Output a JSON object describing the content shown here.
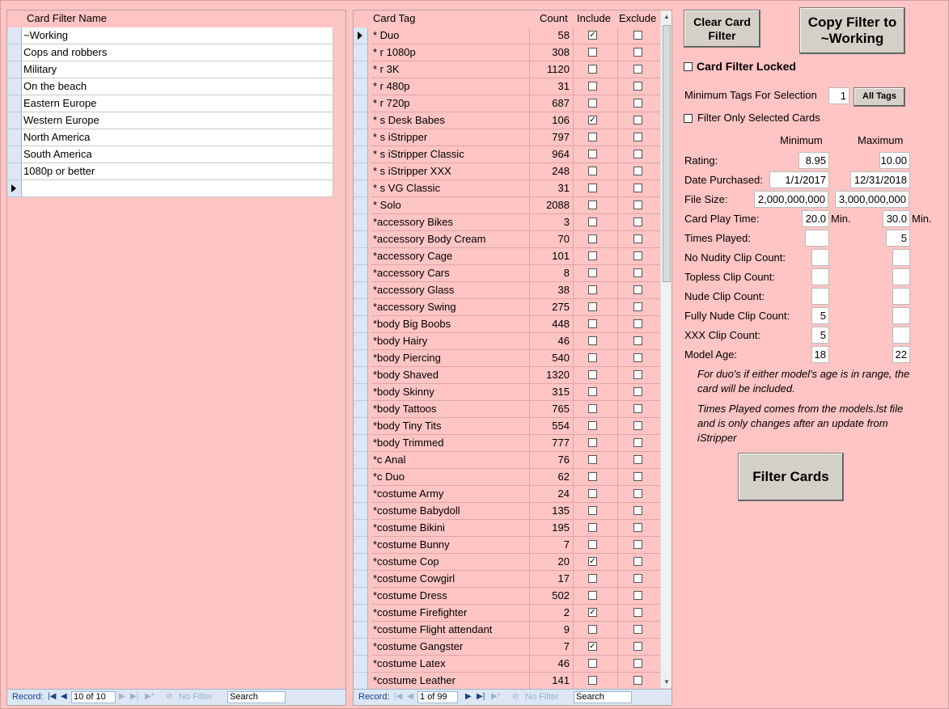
{
  "left": {
    "header": "Card Filter Name",
    "rows": [
      "~Working",
      "Cops and robbers",
      "Military",
      "On the beach",
      "Eastern Europe",
      "Western Europe",
      "North America",
      "South America",
      "1080p or better"
    ],
    "nav": {
      "record_label": "Record:",
      "position": "10 of 10",
      "no_filter": "No Filter",
      "search": "Search"
    }
  },
  "middle": {
    "headers": {
      "tag": "Card Tag",
      "count": "Count",
      "include": "Include",
      "exclude": "Exclude"
    },
    "rows": [
      {
        "tag": "* Duo",
        "count": "58",
        "inc": true,
        "exc": false
      },
      {
        "tag": "* r 1080p",
        "count": "308",
        "inc": false,
        "exc": false
      },
      {
        "tag": "* r 3K",
        "count": "1120",
        "inc": false,
        "exc": false
      },
      {
        "tag": "* r 480p",
        "count": "31",
        "inc": false,
        "exc": false
      },
      {
        "tag": "* r 720p",
        "count": "687",
        "inc": false,
        "exc": false
      },
      {
        "tag": "* s Desk Babes",
        "count": "106",
        "inc": true,
        "exc": false
      },
      {
        "tag": "* s iStripper",
        "count": "797",
        "inc": false,
        "exc": false
      },
      {
        "tag": "* s iStripper Classic",
        "count": "964",
        "inc": false,
        "exc": false
      },
      {
        "tag": "* s iStripper XXX",
        "count": "248",
        "inc": false,
        "exc": false
      },
      {
        "tag": "* s VG Classic",
        "count": "31",
        "inc": false,
        "exc": false
      },
      {
        "tag": "* Solo",
        "count": "2088",
        "inc": false,
        "exc": false
      },
      {
        "tag": "*accessory Bikes",
        "count": "3",
        "inc": false,
        "exc": false
      },
      {
        "tag": "*accessory Body Cream",
        "count": "70",
        "inc": false,
        "exc": false
      },
      {
        "tag": "*accessory Cage",
        "count": "101",
        "inc": false,
        "exc": false
      },
      {
        "tag": "*accessory Cars",
        "count": "8",
        "inc": false,
        "exc": false
      },
      {
        "tag": "*accessory Glass",
        "count": "38",
        "inc": false,
        "exc": false
      },
      {
        "tag": "*accessory Swing",
        "count": "275",
        "inc": false,
        "exc": false
      },
      {
        "tag": "*body Big Boobs",
        "count": "448",
        "inc": false,
        "exc": false
      },
      {
        "tag": "*body Hairy",
        "count": "46",
        "inc": false,
        "exc": false
      },
      {
        "tag": "*body Piercing",
        "count": "540",
        "inc": false,
        "exc": false
      },
      {
        "tag": "*body Shaved",
        "count": "1320",
        "inc": false,
        "exc": false
      },
      {
        "tag": "*body Skinny",
        "count": "315",
        "inc": false,
        "exc": false
      },
      {
        "tag": "*body Tattoos",
        "count": "765",
        "inc": false,
        "exc": false
      },
      {
        "tag": "*body Tiny Tits",
        "count": "554",
        "inc": false,
        "exc": false
      },
      {
        "tag": "*body Trimmed",
        "count": "777",
        "inc": false,
        "exc": false
      },
      {
        "tag": "*c Anal",
        "count": "76",
        "inc": false,
        "exc": false
      },
      {
        "tag": "*c Duo",
        "count": "62",
        "inc": false,
        "exc": false
      },
      {
        "tag": "*costume Army",
        "count": "24",
        "inc": false,
        "exc": false
      },
      {
        "tag": "*costume Babydoll",
        "count": "135",
        "inc": false,
        "exc": false
      },
      {
        "tag": "*costume Bikini",
        "count": "195",
        "inc": false,
        "exc": false
      },
      {
        "tag": "*costume Bunny",
        "count": "7",
        "inc": false,
        "exc": false
      },
      {
        "tag": "*costume Cop",
        "count": "20",
        "inc": true,
        "exc": false
      },
      {
        "tag": "*costume Cowgirl",
        "count": "17",
        "inc": false,
        "exc": false
      },
      {
        "tag": "*costume Dress",
        "count": "502",
        "inc": false,
        "exc": false
      },
      {
        "tag": "*costume Firefighter",
        "count": "2",
        "inc": true,
        "exc": false
      },
      {
        "tag": "*costume Flight attendant",
        "count": "9",
        "inc": false,
        "exc": false
      },
      {
        "tag": "*costume Gangster",
        "count": "7",
        "inc": true,
        "exc": false
      },
      {
        "tag": "*costume Latex",
        "count": "46",
        "inc": false,
        "exc": false
      },
      {
        "tag": "*costume Leather",
        "count": "141",
        "inc": false,
        "exc": false
      }
    ],
    "nav": {
      "record_label": "Record:",
      "position": "1 of 99",
      "no_filter": "No Filter",
      "search": "Search"
    }
  },
  "panel": {
    "clear_button": "Clear Card Filter",
    "copy_button": "Copy Filter to ~Working",
    "locked_label": "Card Filter Locked",
    "min_tags_label": "Minimum Tags For Selection",
    "min_tags_value": "1",
    "all_tags_button": "All Tags",
    "only_selected_label": "Filter Only Selected Cards",
    "col_min": "Minimum",
    "col_max": "Maximum",
    "fields": [
      {
        "label": "Rating:",
        "min": "8.95",
        "max": "10.00"
      },
      {
        "label": "Date Purchased:",
        "min": "1/1/2017",
        "max": "12/31/2018"
      },
      {
        "label": "File Size:",
        "min": "2,000,000,000",
        "max": "3,000,000,000"
      },
      {
        "label": "Card Play Time:",
        "min": "20.0",
        "max": "30.0",
        "unit": "Min."
      },
      {
        "label": "Times Played:",
        "min": "",
        "max": "5"
      },
      {
        "label": "No Nudity Clip Count:",
        "min": "",
        "max": ""
      },
      {
        "label": "Topless Clip Count:",
        "min": "",
        "max": ""
      },
      {
        "label": "Nude Clip Count:",
        "min": "",
        "max": ""
      },
      {
        "label": "Fully Nude Clip Count:",
        "min": "5",
        "max": ""
      },
      {
        "label": "XXX Clip Count:",
        "min": "5",
        "max": ""
      },
      {
        "label": "Model Age:",
        "min": "18",
        "max": "22"
      }
    ],
    "note1": "For duo's if either model's age is in range, the card will be included.",
    "note2": "Times Played comes from the models.lst file and is only changes after an update from iStripper",
    "filter_button": "Filter Cards"
  }
}
